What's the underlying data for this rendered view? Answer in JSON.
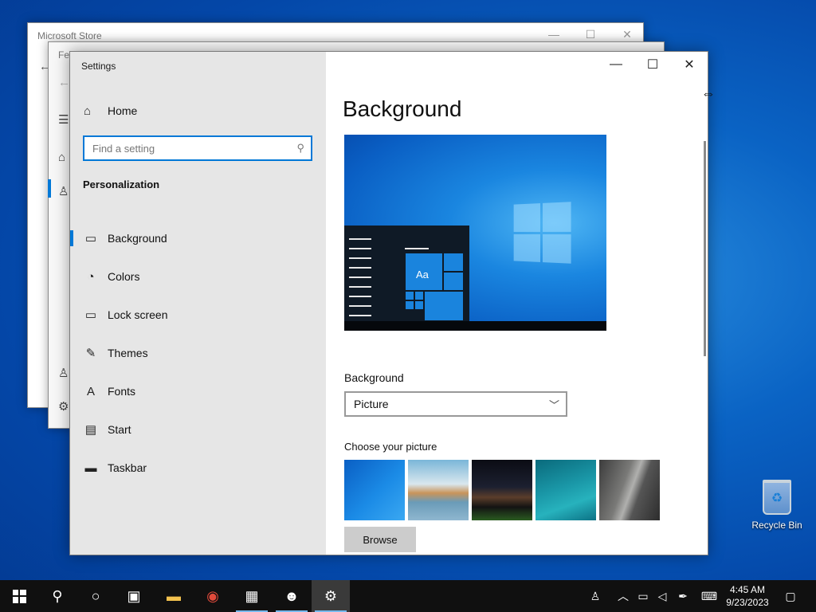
{
  "desktop": {
    "recycle_bin_label": "Recycle Bin"
  },
  "background_windows": {
    "store_title": "Microsoft Store",
    "feedback_title": "Fee"
  },
  "settings": {
    "app_title": "Settings",
    "home_label": "Home",
    "search_placeholder": "Find a setting",
    "section_title": "Personalization",
    "nav": [
      {
        "label": "Background",
        "icon": "image-icon",
        "glyph": "▭",
        "active": true
      },
      {
        "label": "Colors",
        "icon": "palette-icon",
        "glyph": "◔",
        "active": false
      },
      {
        "label": "Lock screen",
        "icon": "lock-screen-icon",
        "glyph": "▭",
        "active": false
      },
      {
        "label": "Themes",
        "icon": "themes-icon",
        "glyph": "✎",
        "active": false
      },
      {
        "label": "Fonts",
        "icon": "fonts-icon",
        "glyph": "A",
        "active": false
      },
      {
        "label": "Start",
        "icon": "start-icon",
        "glyph": "▤",
        "active": false
      },
      {
        "label": "Taskbar",
        "icon": "taskbar-icon",
        "glyph": "▬",
        "active": false
      }
    ],
    "page_title": "Background",
    "preview_tile_text": "Aa",
    "background_label": "Background",
    "background_value": "Picture",
    "choose_picture_label": "Choose your picture",
    "browse_label": "Browse"
  },
  "taskbar": {
    "time": "4:45 AM",
    "date": "9/23/2023"
  },
  "colors": {
    "accent": "#0078d7",
    "taskbar": "#101010"
  }
}
